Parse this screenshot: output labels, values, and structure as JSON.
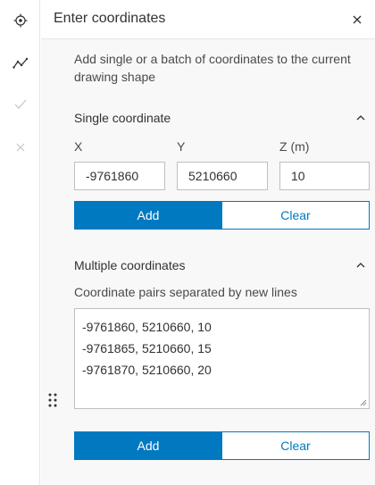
{
  "rail": {
    "items": [
      {
        "name": "locate-icon",
        "active": true
      },
      {
        "name": "polyline-icon",
        "active": true
      },
      {
        "name": "checkmark-icon",
        "active": false
      },
      {
        "name": "close-icon",
        "active": false
      }
    ]
  },
  "header": {
    "title": "Enter coordinates",
    "close_icon": "close-icon"
  },
  "description": "Add single or a batch of coordinates to the current drawing shape",
  "single": {
    "title": "Single coordinate",
    "fields": [
      {
        "label": "X",
        "value": "-9761860"
      },
      {
        "label": "Y",
        "value": "5210660"
      },
      {
        "label": "Z (m)",
        "value": "10"
      }
    ],
    "add_label": "Add",
    "clear_label": "Clear"
  },
  "multiple": {
    "title": "Multiple coordinates",
    "hint": "Coordinate pairs separated by new lines",
    "lines": [
      "-9761860, 5210660, 10",
      "-9761865, 5210660, 15",
      "-9761870, 5210660, 20"
    ],
    "add_label": "Add",
    "clear_label": "Clear"
  },
  "colors": {
    "accent": "#0079c1",
    "icon_active": "#323232",
    "icon_disabled": "#c8c8c8"
  }
}
